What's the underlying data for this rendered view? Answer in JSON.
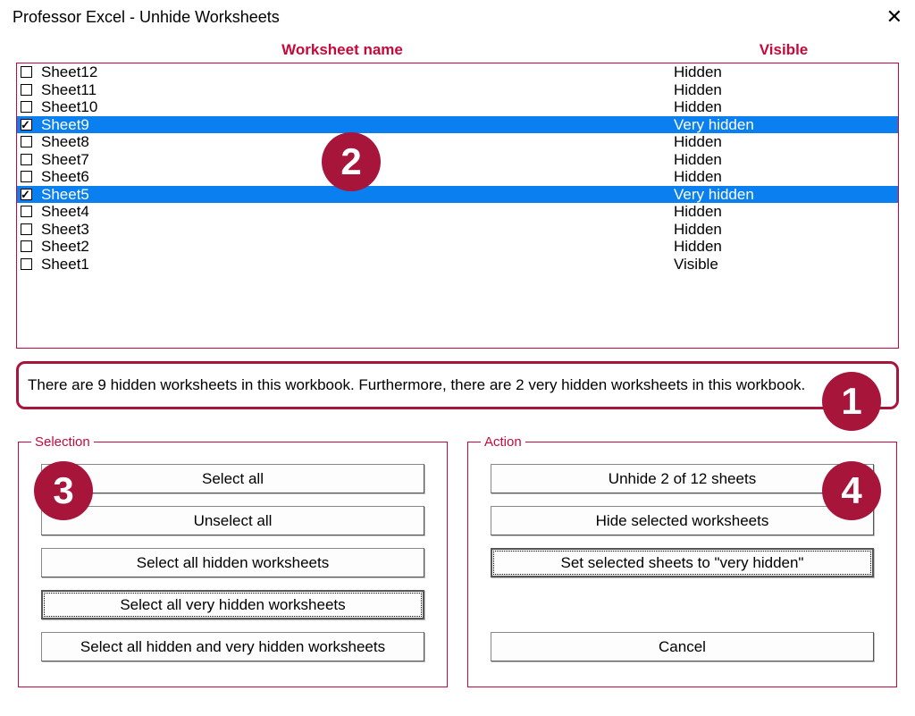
{
  "window": {
    "title": "Professor Excel - Unhide Worksheets"
  },
  "columns": {
    "name": "Worksheet name",
    "visible": "Visible"
  },
  "rows": [
    {
      "name": "Sheet12",
      "visible": "Hidden",
      "checked": false,
      "selected": false
    },
    {
      "name": "Sheet11",
      "visible": "Hidden",
      "checked": false,
      "selected": false
    },
    {
      "name": "Sheet10",
      "visible": "Hidden",
      "checked": false,
      "selected": false
    },
    {
      "name": "Sheet9",
      "visible": "Very hidden",
      "checked": true,
      "selected": true
    },
    {
      "name": "Sheet8",
      "visible": "Hidden",
      "checked": false,
      "selected": false
    },
    {
      "name": "Sheet7",
      "visible": "Hidden",
      "checked": false,
      "selected": false
    },
    {
      "name": "Sheet6",
      "visible": "Hidden",
      "checked": false,
      "selected": false
    },
    {
      "name": "Sheet5",
      "visible": "Very hidden",
      "checked": true,
      "selected": true
    },
    {
      "name": "Sheet4",
      "visible": "Hidden",
      "checked": false,
      "selected": false
    },
    {
      "name": "Sheet3",
      "visible": "Hidden",
      "checked": false,
      "selected": false
    },
    {
      "name": "Sheet2",
      "visible": "Hidden",
      "checked": false,
      "selected": false
    },
    {
      "name": "Sheet1",
      "visible": "Visible",
      "checked": false,
      "selected": false
    }
  ],
  "status": "There are 9 hidden worksheets in this workbook. Furthermore, there are 2 very hidden worksheets in this workbook.",
  "selection_group": {
    "legend": "Selection",
    "select_all": "Select all",
    "unselect_all": "Unselect all",
    "select_hidden": "Select all hidden worksheets",
    "select_very_hidden": "Select all very hidden worksheets",
    "select_both": "Select all hidden and very hidden worksheets"
  },
  "action_group": {
    "legend": "Action",
    "unhide": "Unhide 2 of 12 sheets",
    "hide": "Hide selected worksheets",
    "set_very_hidden": "Set selected sheets to \"very hidden\"",
    "cancel": "Cancel"
  },
  "badges": {
    "b1": "1",
    "b2": "2",
    "b3": "3",
    "b4": "4"
  }
}
